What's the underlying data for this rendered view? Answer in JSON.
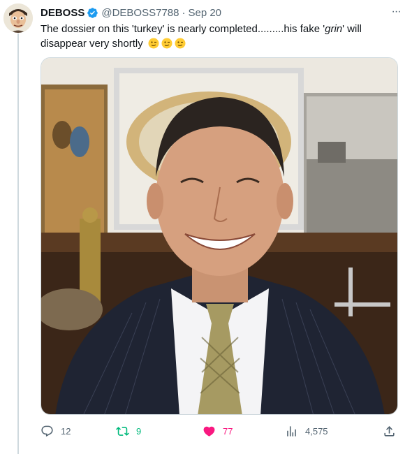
{
  "tweet": {
    "author_name": "DEBOSS",
    "handle": "@DEBOSS7788",
    "separator": "·",
    "date": "Sep 20",
    "text": "The dossier on this 'turkey' is nearly completed.........his fake '",
    "text_italic": "grin",
    "text_end": "' will disappear very shortly",
    "emoji_names": [
      "winking-face-emoji",
      "winking-face-emoji",
      "winking-face-emoji"
    ],
    "verified": true
  },
  "more_button": {
    "label": "···",
    "icon": "more-horizontal-icon"
  },
  "media": {
    "description_icon": "photo-of-smiling-man-in-pinstripe-suit"
  },
  "actions": {
    "replies": "12",
    "retweets": "9",
    "likes": "77",
    "views": "4,575"
  },
  "colors": {
    "accent_blue": "#1d9bf0",
    "retweet_green": "#00ba7c",
    "like_pink": "#f91880",
    "muted_text": "#536471"
  }
}
